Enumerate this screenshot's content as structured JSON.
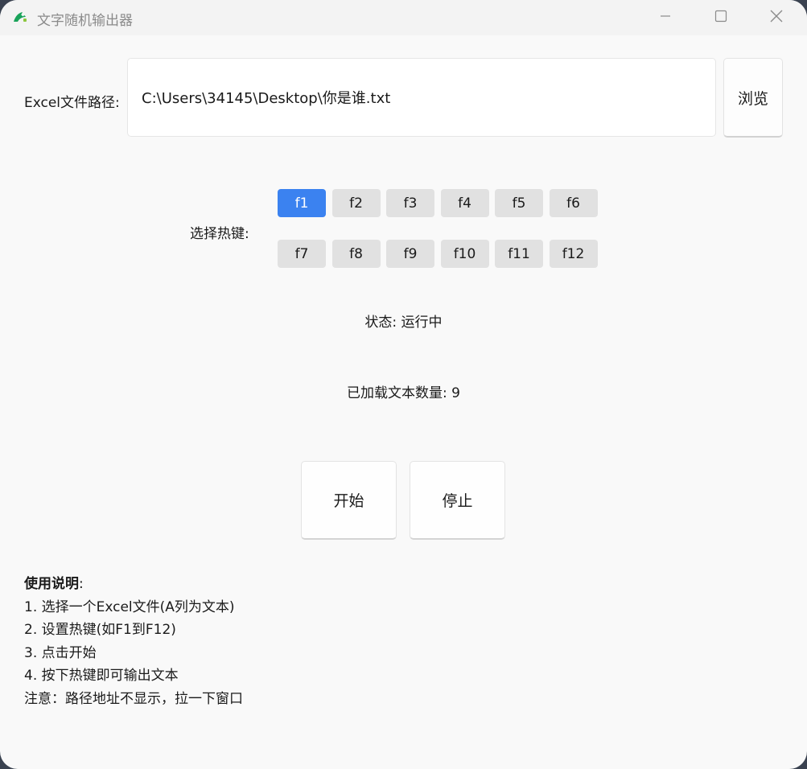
{
  "window": {
    "title": "文字随机输出器"
  },
  "path": {
    "label": "Excel文件路径:",
    "value": "C:\\Users\\34145\\Desktop\\你是谁.txt",
    "browse_label": "浏览"
  },
  "hotkeys": {
    "label": "选择热键:",
    "selected": "f1",
    "keys": [
      "f1",
      "f2",
      "f3",
      "f4",
      "f5",
      "f6",
      "f7",
      "f8",
      "f9",
      "f10",
      "f11",
      "f12"
    ]
  },
  "status": {
    "text": "状态: 运行中"
  },
  "loaded": {
    "text": "已加载文本数量: 9"
  },
  "actions": {
    "start_label": "开始",
    "stop_label": "停止"
  },
  "instructions": {
    "title": "使用说明",
    "colon": ":",
    "lines": [
      "1. 选择一个Excel文件(A列为文本)",
      "2. 设置热键(如F1到F12)",
      "3. 点击开始",
      "4. 按下热键即可输出文本",
      "注意：路径地址不显示，拉一下窗口"
    ]
  },
  "colors": {
    "accent": "#3b82f0",
    "key_background": "#e1e1e1",
    "window_background": "#f9f9f9"
  }
}
